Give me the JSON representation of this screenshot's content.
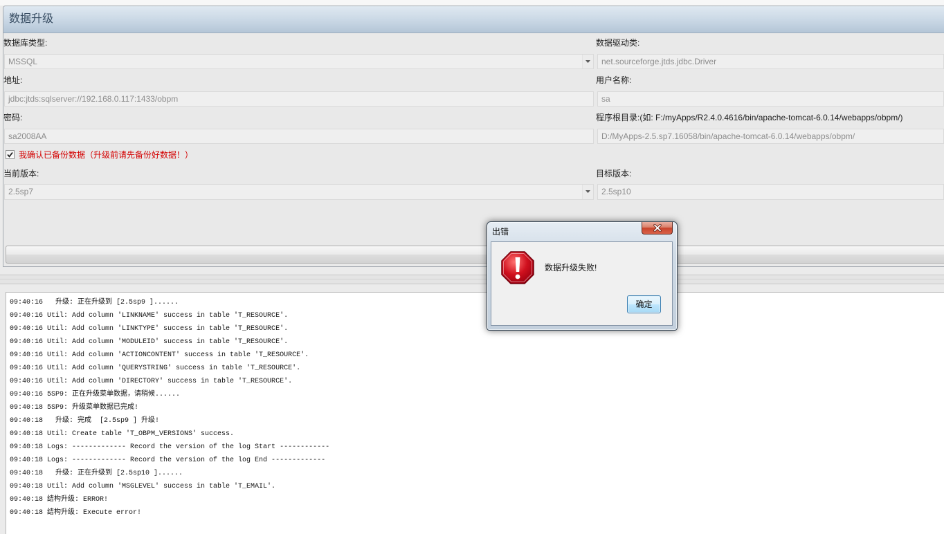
{
  "panel": {
    "title": "数据升级"
  },
  "form": {
    "db_type": {
      "label": "数据库类型:",
      "value": "MSSQL"
    },
    "driver_class": {
      "label": "数据驱动类:",
      "value": "net.sourceforge.jtds.jdbc.Driver"
    },
    "address": {
      "label": "地址:",
      "value": "jdbc:jtds:sqlserver://192.168.0.117:1433/obpm"
    },
    "username": {
      "label": "用户名称:",
      "value": "sa"
    },
    "password": {
      "label": "密码:",
      "value": "sa2008AA"
    },
    "root_dir": {
      "label": "程序根目录:(如: F:/myApps/R2.4.0.4616/bin/apache-tomcat-6.0.14/webapps/obpm/)",
      "value": "D:/MyApps-2.5.sp7.16058/bin/apache-tomcat-6.0.14/webapps/obpm/"
    },
    "backup_confirm": {
      "label": "我确认已备份数据（升级前请先备份好数据！）",
      "checked": true
    },
    "current_version": {
      "label": "当前版本:",
      "value": "2.5sp7"
    },
    "target_version": {
      "label": "目标版本:",
      "value": "2.5sp10"
    }
  },
  "log": {
    "lines": [
      "09:40:16   升级: 正在升级到 [2.5sp9 ]......",
      "09:40:16 Util: Add column 'LINKNAME' success in table 'T_RESOURCE'.",
      "09:40:16 Util: Add column 'LINKTYPE' success in table 'T_RESOURCE'.",
      "09:40:16 Util: Add column 'MODULEID' success in table 'T_RESOURCE'.",
      "09:40:16 Util: Add column 'ACTIONCONTENT' success in table 'T_RESOURCE'.",
      "09:40:16 Util: Add column 'QUERYSTRING' success in table 'T_RESOURCE'.",
      "09:40:16 Util: Add column 'DIRECTORY' success in table 'T_RESOURCE'.",
      "09:40:16 5SP9: 正在升级菜单数据，请稍候......",
      "09:40:18 5SP9: 升级菜单数据已完成!",
      "09:40:18   升级: 完成  [2.5sp9 ] 升级!",
      "09:40:18 Util: Create table 'T_OBPM_VERSIONS' success.",
      "09:40:18 Logs: ------------- Record the version of the log Start ------------",
      "09:40:18 Logs: ------------- Record the version of the log End -------------",
      "09:40:18   升级: 正在升级到 [2.5sp10 ]......",
      "09:40:18 Util: Add column 'MSGLEVEL' success in table 'T_EMAIL'.",
      "09:40:18 结构升级: ERROR!",
      "09:40:18 结构升级: Execute error!"
    ]
  },
  "dialog": {
    "title": "出错",
    "message": "数据升级失败!",
    "ok_label": "确定"
  },
  "icons": {
    "dropdown": "chevron-down-icon",
    "checkbox": "checkmark-icon",
    "dialog_close": "close-icon",
    "dialog_type": "error-icon"
  },
  "colors": {
    "warning_text": "#d40000",
    "error_icon": "#d0101e",
    "dialog_close": "#c9432a",
    "default_button_border": "#3c7fb1"
  }
}
